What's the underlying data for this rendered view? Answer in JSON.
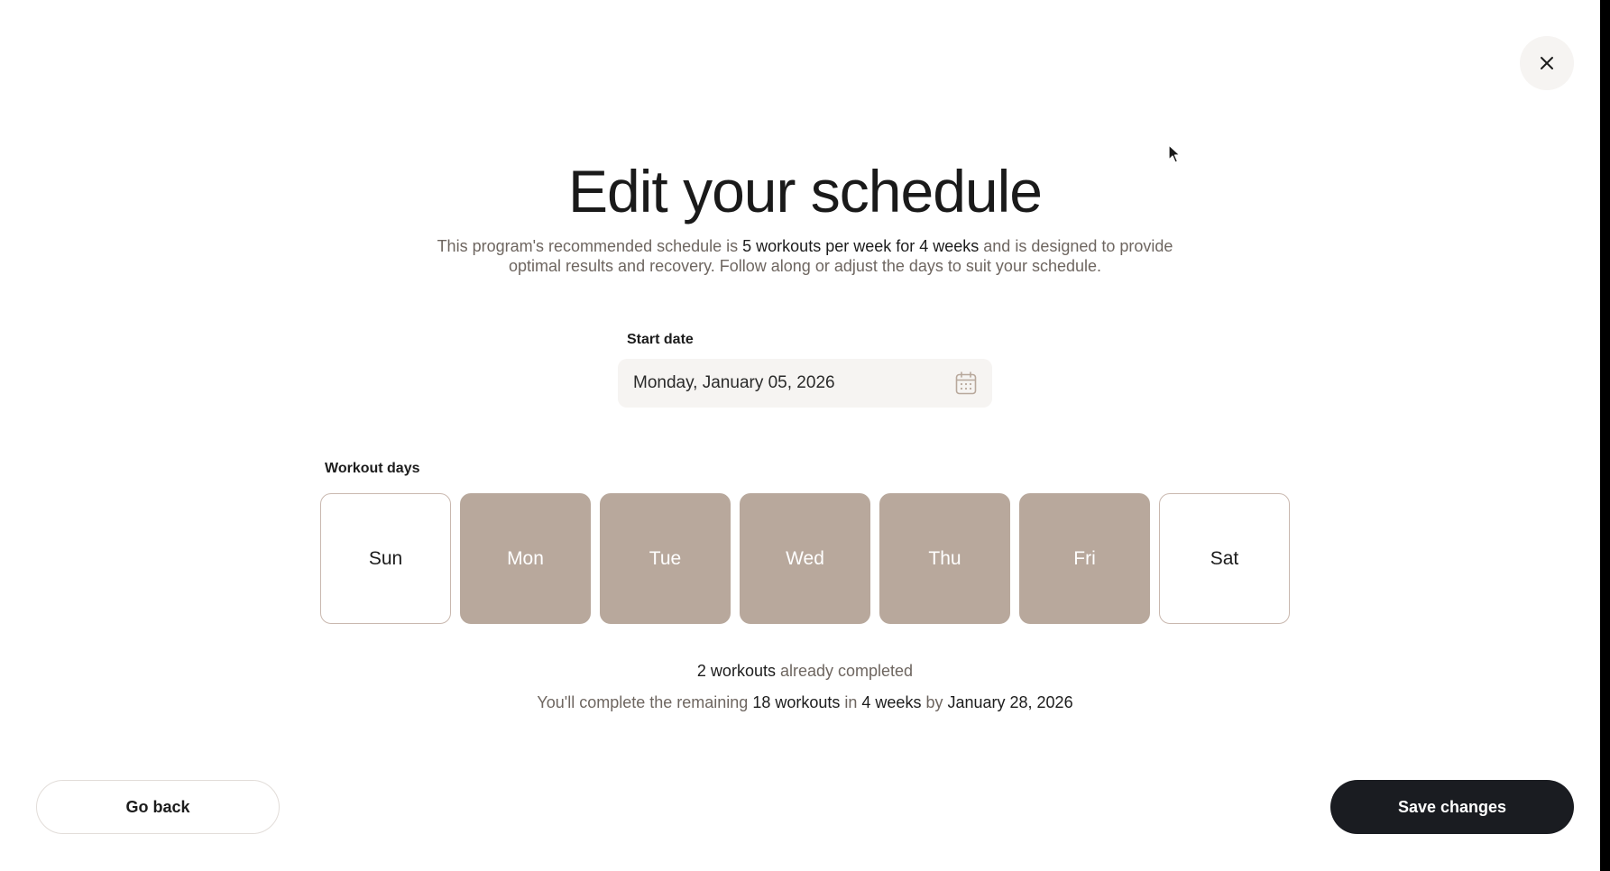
{
  "header": {
    "close_icon": "close-icon"
  },
  "main": {
    "title": "Edit your schedule",
    "description": {
      "part1": "This program's recommended schedule is ",
      "highlight1": "5 workouts per week for 4 weeks",
      "part2": " and is designed to provide optimal results and recovery. Follow along or adjust the days to suit your schedule."
    },
    "start_date": {
      "label": "Start date",
      "value": "Monday, January 05, 2026",
      "icon": "calendar-icon"
    },
    "workout_days": {
      "label": "Workout days",
      "days": [
        {
          "label": "Sun",
          "selected": false
        },
        {
          "label": "Mon",
          "selected": true
        },
        {
          "label": "Tue",
          "selected": true
        },
        {
          "label": "Wed",
          "selected": true
        },
        {
          "label": "Thu",
          "selected": true
        },
        {
          "label": "Fri",
          "selected": true
        },
        {
          "label": "Sat",
          "selected": false
        }
      ]
    },
    "summary": {
      "completed_count": "2 workouts",
      "completed_text": " already completed",
      "line2_part1": "You'll complete the remaining ",
      "line2_remaining": "18 workouts",
      "line2_part2": " in ",
      "line2_weeks": "4 weeks",
      "line2_part3": " by ",
      "line2_date": "January 28, 2026"
    }
  },
  "footer": {
    "go_back_label": "Go back",
    "save_label": "Save changes"
  },
  "colors": {
    "selected_day": "#b8a89c",
    "primary_button": "#1a1c21",
    "muted_text": "#6e6660"
  }
}
